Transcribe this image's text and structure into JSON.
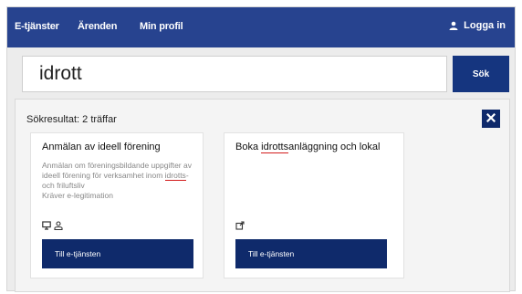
{
  "nav": {
    "items": [
      "E-tjänster",
      "Ärenden",
      "Min profil"
    ],
    "login_label": "Logga in"
  },
  "search": {
    "query": "idrott",
    "button_label": "Sök"
  },
  "results": {
    "title": "Sökresultat: 2 träffar",
    "cards": [
      {
        "title": "Anmälan av ideell förening",
        "description": "Anmälan om föreningsbildande uppgifter av ideell förening för verksamhet inom idrotts- och friluftsliv Kräver e-legitimation",
        "desc_before": "Anmälan om föreningsbildande uppgifter av ideell förening för verksamhet inom ",
        "desc_match": "idrotts",
        "desc_after": "- och friluftsliv",
        "desc_line2": "Kräver e-legitimation",
        "icons": [
          "computer-icon",
          "person-icon"
        ],
        "button_label": "Till e-tjänsten"
      },
      {
        "title": "Boka idrottsanläggning och lokal",
        "title_before": "Boka ",
        "title_match": "idrotts",
        "title_after": "anläggning och lokal",
        "icons": [
          "external-link-icon"
        ],
        "button_label": "Till e-tjänsten"
      }
    ]
  },
  "colors": {
    "topbar": "#27438f",
    "button": "#0f2a6b",
    "highlight_underline": "#d31c1c"
  }
}
